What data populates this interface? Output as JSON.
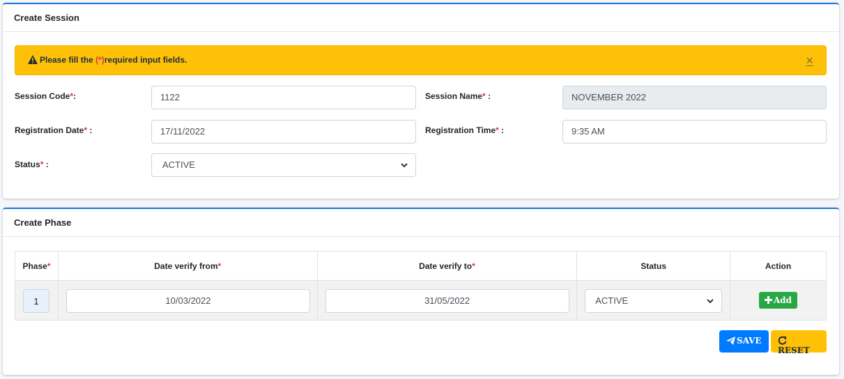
{
  "session": {
    "title": "Create Session",
    "alert": {
      "prefix": "Please fill the ",
      "required_marker": "(*)",
      "suffix": "required input fields.",
      "close": "×"
    },
    "fields": {
      "session_code": {
        "label": "Session Code",
        "star": "*",
        "colon": ":",
        "value": "1122"
      },
      "session_name": {
        "label": "Session Name",
        "star": "*",
        "colon": " :",
        "value": "NOVEMBER 2022"
      },
      "registration_date": {
        "label": "Registration Date",
        "star": "*",
        "colon": " :",
        "value": "17/11/2022"
      },
      "registration_time": {
        "label": "Registration Time",
        "star": "*",
        "colon": " :",
        "value": "9:35 AM"
      },
      "status": {
        "label": "Status",
        "star": "*",
        "colon": " :",
        "value": "ACTIVE"
      }
    }
  },
  "phase": {
    "title": "Create Phase",
    "columns": {
      "phase": "Phase",
      "date_from": "Date verify from",
      "date_to": "Date verify to",
      "status": "Status",
      "action": "Action",
      "star": "*"
    },
    "row": {
      "phase": "1",
      "date_from": "10/03/2022",
      "date_to": "31/05/2022",
      "status": "ACTIVE",
      "add_label": "Add"
    },
    "save_label": "SAVE",
    "reset_label": "RESET"
  },
  "colors": {
    "accent": "#007bff",
    "warning": "#ffc107",
    "success": "#28a745",
    "required": "#dc3545"
  },
  "icons": [
    "warning-triangle-icon",
    "close-icon",
    "chevron-down-icon",
    "plus-icon",
    "send-icon",
    "redo-icon"
  ]
}
